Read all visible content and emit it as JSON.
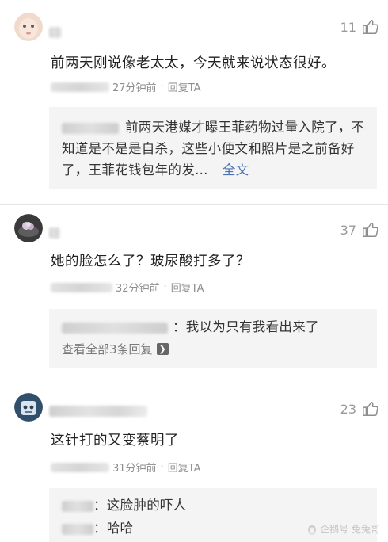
{
  "comments": [
    {
      "likes": "11",
      "text": "前两天刚说像老太太，今天就来说状态很好。",
      "time": "27分钟前",
      "reply": "回复TA",
      "quote": {
        "text": "前两天港媒才曝王菲药物过量入院了，不知道是不是是自杀，这些小便文和照片是之前备好了，王菲花钱包年的发…",
        "more": "全文"
      }
    },
    {
      "likes": "37",
      "text": "她的脸怎么了？玻尿酸打多了？",
      "time": "32分钟前",
      "reply": "回复TA",
      "quote": {
        "text": "：我以为只有我看出来了",
        "view_all": "查看全部3条回复",
        "arrow": "❯"
      }
    },
    {
      "likes": "23",
      "text": "这针打的又变蔡明了",
      "time": "31分钟前",
      "reply": "回复TA",
      "replies": [
        {
          "text": "：这脸肿的吓人"
        },
        {
          "text": "：哈哈"
        }
      ]
    }
  ],
  "separator": "·",
  "watermark": "企鹅号 兔兔哥"
}
